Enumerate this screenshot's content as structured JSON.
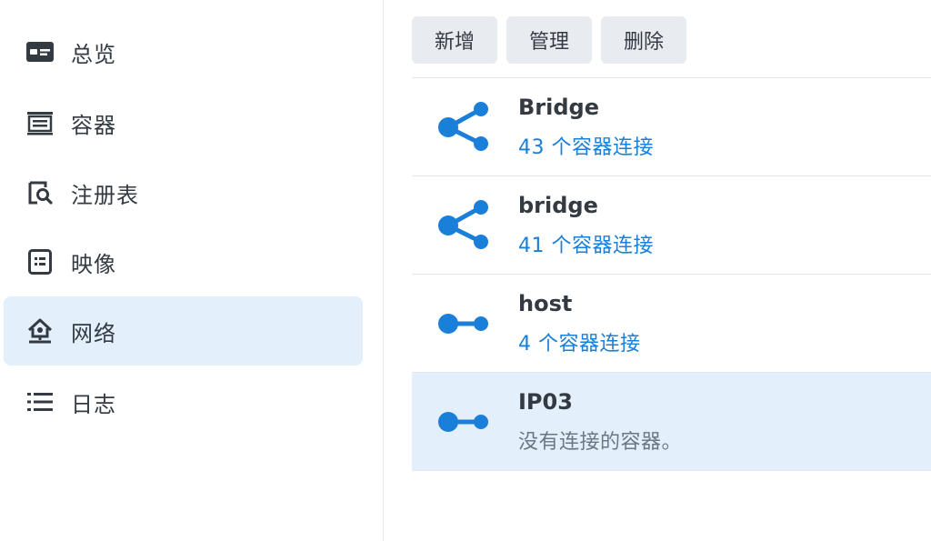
{
  "sidebar": {
    "items": [
      {
        "label": "总览",
        "icon": "overview-card-icon",
        "active": false
      },
      {
        "label": "容器",
        "icon": "container-list-icon",
        "active": false
      },
      {
        "label": "注册表",
        "icon": "registry-search-icon",
        "active": false
      },
      {
        "label": "映像",
        "icon": "image-file-icon",
        "active": false
      },
      {
        "label": "网络",
        "icon": "network-house-icon",
        "active": true
      },
      {
        "label": "日志",
        "icon": "log-list-icon",
        "active": false
      }
    ]
  },
  "toolbar": {
    "add_label": "新增",
    "manage_label": "管理",
    "delete_label": "删除"
  },
  "networks": [
    {
      "name": "Bridge",
      "status": "43 个容器连接",
      "icon": "share-network-icon",
      "selected": false
    },
    {
      "name": "bridge",
      "status": "41 个容器连接",
      "icon": "share-network-icon",
      "selected": false
    },
    {
      "name": "host",
      "status": "4 个容器连接",
      "icon": "link-network-icon",
      "selected": false
    },
    {
      "name": "IP03",
      "status": "没有连接的容器。",
      "icon": "link-network-icon",
      "selected": true
    }
  ],
  "colors": {
    "accent": "#1a7fd9",
    "selected_bg": "#e3effb",
    "button_bg": "#e8ecf1",
    "text": "#333a42",
    "muted": "#6b7785"
  }
}
